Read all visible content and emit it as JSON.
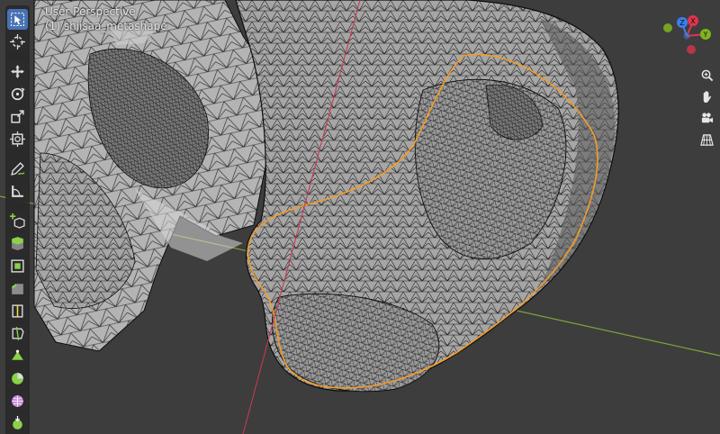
{
  "viewport": {
    "mode_label": "User Perspective",
    "object_label": "(1) shiisaa_metashape"
  },
  "toolbar": {
    "tools": [
      {
        "name": "select-box",
        "active": true
      },
      {
        "name": "cursor",
        "active": false
      },
      {
        "name": "move",
        "active": false
      },
      {
        "name": "rotate",
        "active": false
      },
      {
        "name": "scale",
        "active": false
      },
      {
        "name": "transform",
        "active": false
      },
      {
        "name": "annotate",
        "active": false
      },
      {
        "name": "measure",
        "active": false
      },
      {
        "name": "add-cube",
        "active": false
      },
      {
        "name": "extrude-region",
        "active": false
      },
      {
        "name": "inset-faces",
        "active": false
      },
      {
        "name": "bevel",
        "active": false
      },
      {
        "name": "loop-cut",
        "active": false
      },
      {
        "name": "knife",
        "active": false
      },
      {
        "name": "poly-build",
        "active": false
      },
      {
        "name": "spin",
        "active": false
      },
      {
        "name": "smooth",
        "active": false
      },
      {
        "name": "shrink-fatten",
        "active": false
      }
    ]
  },
  "gizmo": {
    "axes": [
      {
        "label": "X",
        "color": "#e0344f"
      },
      {
        "label": "Y",
        "color": "#7fb51f"
      },
      {
        "label": "Z",
        "color": "#3b7ff0"
      }
    ]
  },
  "navigation": [
    "zoom-icon",
    "pan-hand-icon",
    "camera-icon",
    "perspective-grid-icon"
  ],
  "colors": {
    "background": "#3d3d3d",
    "mesh_face": "#a4a4a4",
    "wire": "#111111",
    "selection_outline": "#f39c2a",
    "x_axis_line": "#c23a52",
    "y_axis_line": "#7ea53a",
    "active_tool": "#4772b3"
  }
}
